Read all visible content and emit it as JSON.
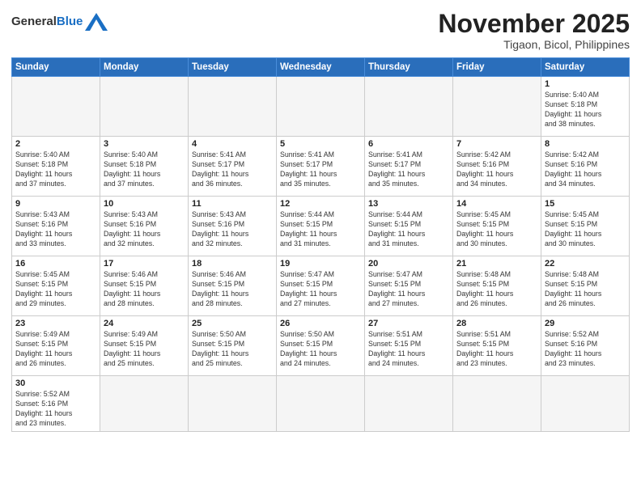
{
  "header": {
    "logo_general": "General",
    "logo_blue": "Blue",
    "month_title": "November 2025",
    "subtitle": "Tigaon, Bicol, Philippines"
  },
  "weekdays": [
    "Sunday",
    "Monday",
    "Tuesday",
    "Wednesday",
    "Thursday",
    "Friday",
    "Saturday"
  ],
  "weeks": [
    [
      {
        "day": "",
        "info": ""
      },
      {
        "day": "",
        "info": ""
      },
      {
        "day": "",
        "info": ""
      },
      {
        "day": "",
        "info": ""
      },
      {
        "day": "",
        "info": ""
      },
      {
        "day": "",
        "info": ""
      },
      {
        "day": "1",
        "info": "Sunrise: 5:40 AM\nSunset: 5:18 PM\nDaylight: 11 hours\nand 38 minutes."
      }
    ],
    [
      {
        "day": "2",
        "info": "Sunrise: 5:40 AM\nSunset: 5:18 PM\nDaylight: 11 hours\nand 37 minutes."
      },
      {
        "day": "3",
        "info": "Sunrise: 5:40 AM\nSunset: 5:18 PM\nDaylight: 11 hours\nand 37 minutes."
      },
      {
        "day": "4",
        "info": "Sunrise: 5:41 AM\nSunset: 5:17 PM\nDaylight: 11 hours\nand 36 minutes."
      },
      {
        "day": "5",
        "info": "Sunrise: 5:41 AM\nSunset: 5:17 PM\nDaylight: 11 hours\nand 35 minutes."
      },
      {
        "day": "6",
        "info": "Sunrise: 5:41 AM\nSunset: 5:17 PM\nDaylight: 11 hours\nand 35 minutes."
      },
      {
        "day": "7",
        "info": "Sunrise: 5:42 AM\nSunset: 5:16 PM\nDaylight: 11 hours\nand 34 minutes."
      },
      {
        "day": "8",
        "info": "Sunrise: 5:42 AM\nSunset: 5:16 PM\nDaylight: 11 hours\nand 34 minutes."
      }
    ],
    [
      {
        "day": "9",
        "info": "Sunrise: 5:43 AM\nSunset: 5:16 PM\nDaylight: 11 hours\nand 33 minutes."
      },
      {
        "day": "10",
        "info": "Sunrise: 5:43 AM\nSunset: 5:16 PM\nDaylight: 11 hours\nand 32 minutes."
      },
      {
        "day": "11",
        "info": "Sunrise: 5:43 AM\nSunset: 5:16 PM\nDaylight: 11 hours\nand 32 minutes."
      },
      {
        "day": "12",
        "info": "Sunrise: 5:44 AM\nSunset: 5:15 PM\nDaylight: 11 hours\nand 31 minutes."
      },
      {
        "day": "13",
        "info": "Sunrise: 5:44 AM\nSunset: 5:15 PM\nDaylight: 11 hours\nand 31 minutes."
      },
      {
        "day": "14",
        "info": "Sunrise: 5:45 AM\nSunset: 5:15 PM\nDaylight: 11 hours\nand 30 minutes."
      },
      {
        "day": "15",
        "info": "Sunrise: 5:45 AM\nSunset: 5:15 PM\nDaylight: 11 hours\nand 30 minutes."
      }
    ],
    [
      {
        "day": "16",
        "info": "Sunrise: 5:45 AM\nSunset: 5:15 PM\nDaylight: 11 hours\nand 29 minutes."
      },
      {
        "day": "17",
        "info": "Sunrise: 5:46 AM\nSunset: 5:15 PM\nDaylight: 11 hours\nand 28 minutes."
      },
      {
        "day": "18",
        "info": "Sunrise: 5:46 AM\nSunset: 5:15 PM\nDaylight: 11 hours\nand 28 minutes."
      },
      {
        "day": "19",
        "info": "Sunrise: 5:47 AM\nSunset: 5:15 PM\nDaylight: 11 hours\nand 27 minutes."
      },
      {
        "day": "20",
        "info": "Sunrise: 5:47 AM\nSunset: 5:15 PM\nDaylight: 11 hours\nand 27 minutes."
      },
      {
        "day": "21",
        "info": "Sunrise: 5:48 AM\nSunset: 5:15 PM\nDaylight: 11 hours\nand 26 minutes."
      },
      {
        "day": "22",
        "info": "Sunrise: 5:48 AM\nSunset: 5:15 PM\nDaylight: 11 hours\nand 26 minutes."
      }
    ],
    [
      {
        "day": "23",
        "info": "Sunrise: 5:49 AM\nSunset: 5:15 PM\nDaylight: 11 hours\nand 26 minutes."
      },
      {
        "day": "24",
        "info": "Sunrise: 5:49 AM\nSunset: 5:15 PM\nDaylight: 11 hours\nand 25 minutes."
      },
      {
        "day": "25",
        "info": "Sunrise: 5:50 AM\nSunset: 5:15 PM\nDaylight: 11 hours\nand 25 minutes."
      },
      {
        "day": "26",
        "info": "Sunrise: 5:50 AM\nSunset: 5:15 PM\nDaylight: 11 hours\nand 24 minutes."
      },
      {
        "day": "27",
        "info": "Sunrise: 5:51 AM\nSunset: 5:15 PM\nDaylight: 11 hours\nand 24 minutes."
      },
      {
        "day": "28",
        "info": "Sunrise: 5:51 AM\nSunset: 5:15 PM\nDaylight: 11 hours\nand 23 minutes."
      },
      {
        "day": "29",
        "info": "Sunrise: 5:52 AM\nSunset: 5:16 PM\nDaylight: 11 hours\nand 23 minutes."
      }
    ],
    [
      {
        "day": "30",
        "info": "Sunrise: 5:52 AM\nSunset: 5:16 PM\nDaylight: 11 hours\nand 23 minutes."
      },
      {
        "day": "",
        "info": ""
      },
      {
        "day": "",
        "info": ""
      },
      {
        "day": "",
        "info": ""
      },
      {
        "day": "",
        "info": ""
      },
      {
        "day": "",
        "info": ""
      },
      {
        "day": "",
        "info": ""
      }
    ]
  ]
}
